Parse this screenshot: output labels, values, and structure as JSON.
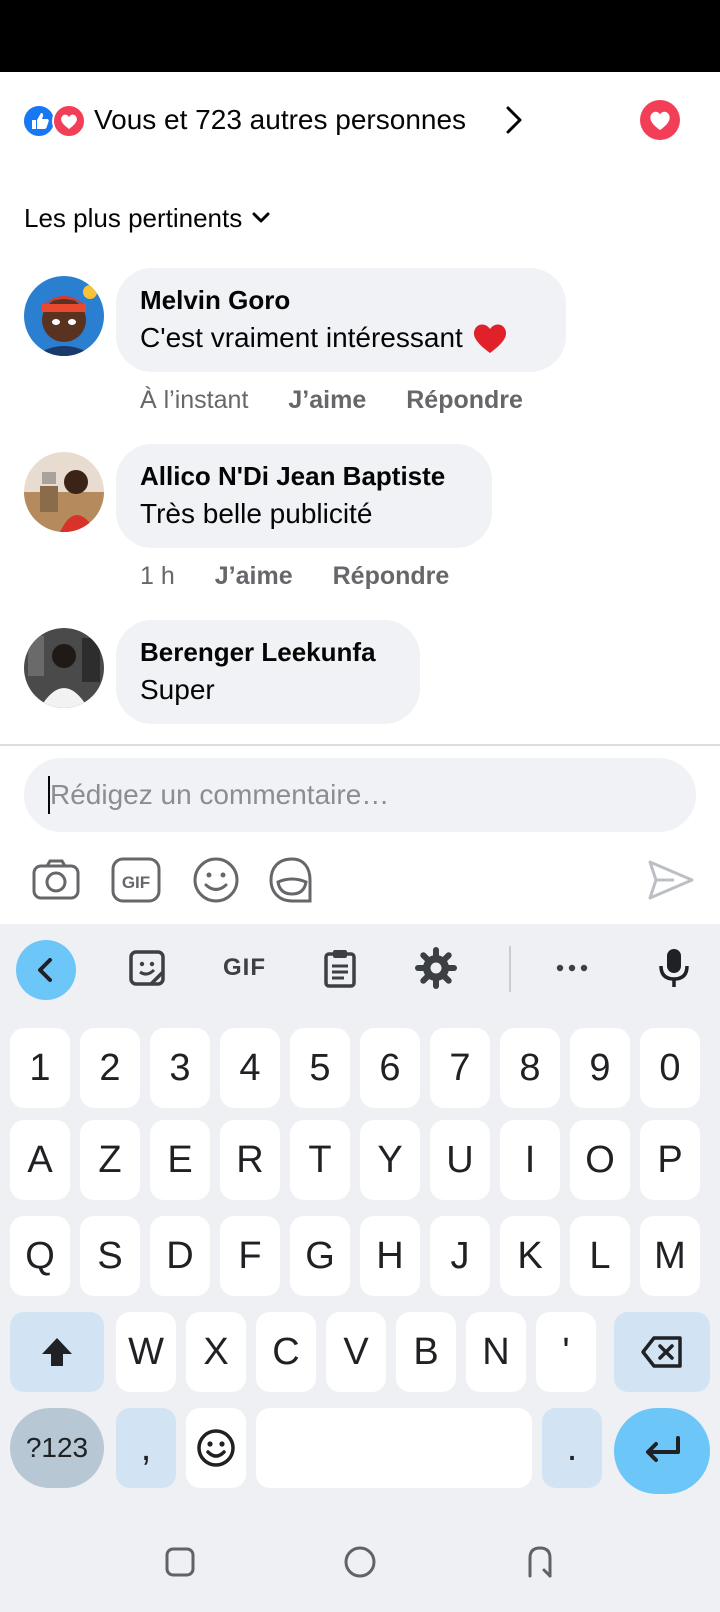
{
  "reactions": {
    "summary": "Vous et 723 autres personnes"
  },
  "sort": {
    "label": "Les plus pertinents"
  },
  "comments": [
    {
      "author": "Melvin Goro",
      "text": "C'est vraiment intéressant",
      "time": "À l’instant",
      "like": "J’aime",
      "reply": "Répondre"
    },
    {
      "author": "Allico N'Di Jean Baptiste",
      "text": "Très belle publicité",
      "time": "1 h",
      "like": "J’aime",
      "reply": "Répondre"
    },
    {
      "author": "Berenger Leekunfa",
      "text": "Super"
    }
  ],
  "composer": {
    "placeholder": "Rédigez un commentaire…"
  },
  "keyboard": {
    "gif_label": "GIF",
    "rows": [
      [
        "1",
        "2",
        "3",
        "4",
        "5",
        "6",
        "7",
        "8",
        "9",
        "0"
      ],
      [
        "A",
        "Z",
        "E",
        "R",
        "T",
        "Y",
        "U",
        "I",
        "O",
        "P"
      ],
      [
        "Q",
        "S",
        "D",
        "F",
        "G",
        "H",
        "J",
        "K",
        "L",
        "M"
      ],
      [
        "W",
        "X",
        "C",
        "V",
        "B",
        "N",
        "'"
      ]
    ],
    "symbols_key": "?123",
    "comma_key": ",",
    "period_key": "."
  },
  "colors": {
    "brand_blue": "#1877f2",
    "love_red": "#f33e58",
    "keyboard_accent": "#6cc6f8"
  }
}
